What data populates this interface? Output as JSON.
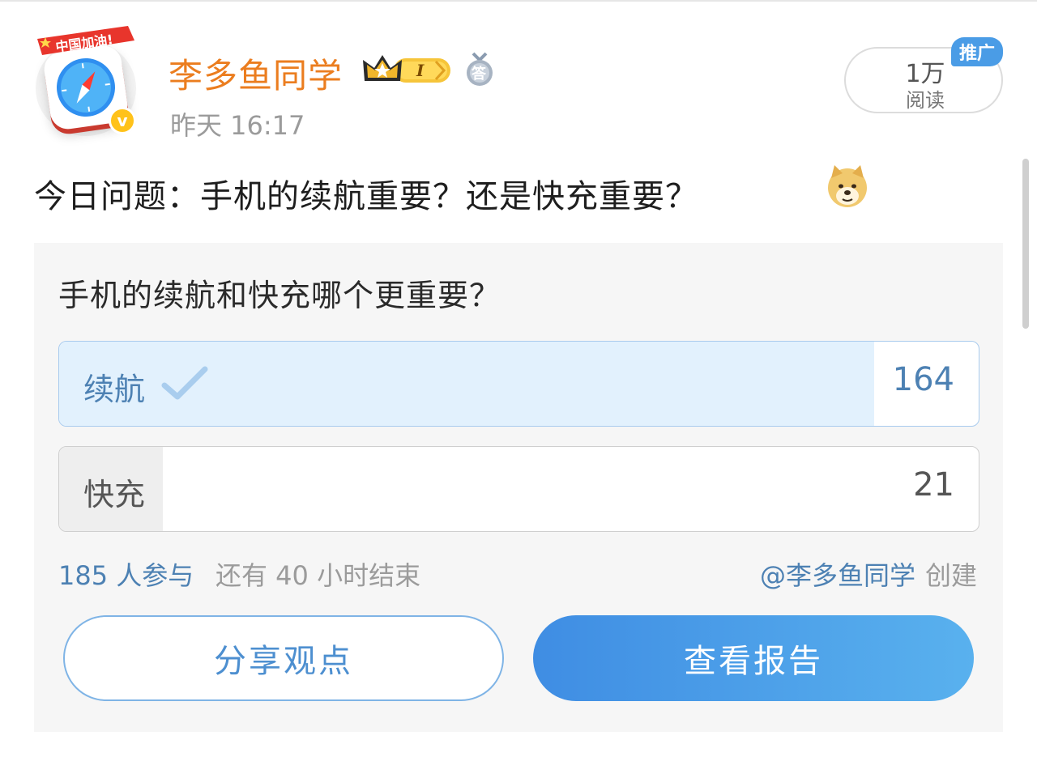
{
  "author": {
    "avatar_banner": "中国加油!",
    "avatar_icon": "safari-compass-icon",
    "verified_icon": "verified-v-badge",
    "verified_mark": "v",
    "name": "李多鱼同学",
    "crown_badge_text": "I",
    "medal_badge_text": "答",
    "time": "昨天 16:17"
  },
  "reads": {
    "count": "1万",
    "label": "阅读"
  },
  "promo_tag": "推广",
  "post": {
    "text": "今日问题：手机的续航重要？还是快充重要？",
    "emoji": "doge-emoji"
  },
  "poll": {
    "question": "手机的续航和快充哪个更重要？",
    "options": [
      {
        "label": "续航",
        "count": "164",
        "selected": true,
        "share": 0.886
      },
      {
        "label": "快充",
        "count": "21",
        "selected": false,
        "share": 0.113
      }
    ],
    "participants": "185 人参与",
    "remaining": "还有 40 小时结束",
    "creator_name": "@李多鱼同学",
    "creator_suffix": "创建",
    "share_button": "分享观点",
    "report_button": "查看报告"
  },
  "colors": {
    "username": "#eb7d1f",
    "link_blue": "#4d81b3",
    "selected_fill": "#e2f1fd",
    "unselected_fill": "#eeeeee",
    "report_button_gradient": [
      "#3f8de3",
      "#59b1ee"
    ],
    "promo": "#4a9ce6"
  }
}
